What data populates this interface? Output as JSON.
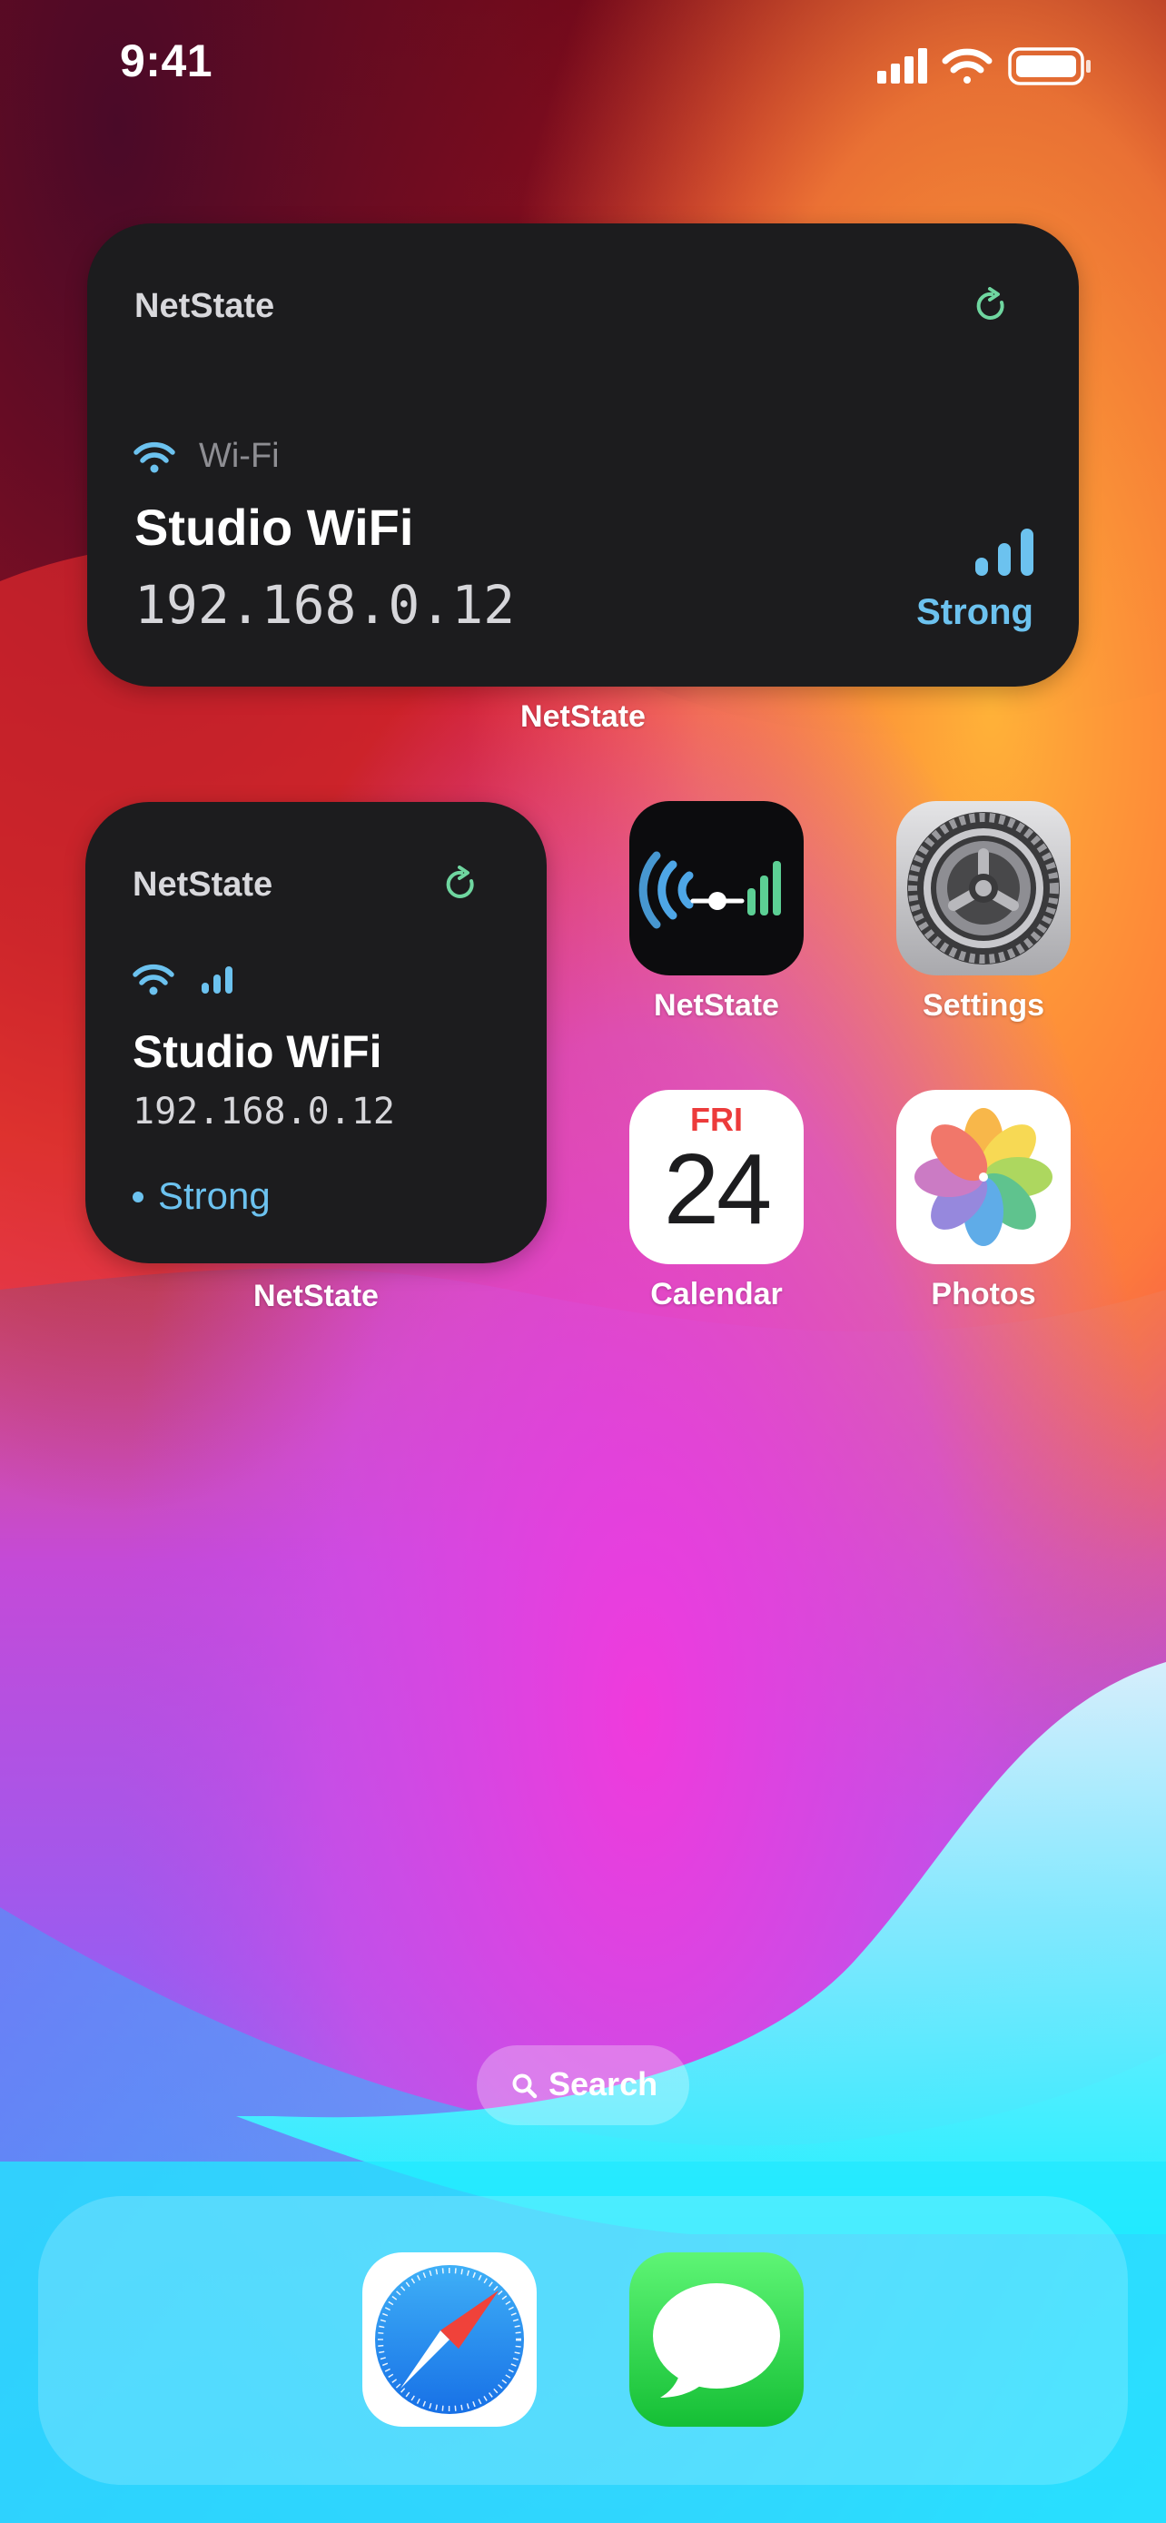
{
  "status_bar": {
    "time": "9:41"
  },
  "widget_large": {
    "app_name": "NetState",
    "connection_type": "Wi-Fi",
    "ssid": "Studio WiFi",
    "ip": "192.168.0.12",
    "strength": "Strong",
    "caption": "NetState"
  },
  "widget_small": {
    "app_name": "NetState",
    "ssid": "Studio WiFi",
    "ip": "192.168.0.12",
    "strength": "Strong",
    "caption": "NetState"
  },
  "apps": [
    {
      "label": "NetState",
      "icon": "netstate-app-icon"
    },
    {
      "label": "Settings",
      "icon": "settings-gear-icon"
    },
    {
      "label": "Calendar",
      "icon": "calendar-icon",
      "day": "FRI",
      "date": "24"
    },
    {
      "label": "Photos",
      "icon": "photos-flower-icon"
    }
  ],
  "search": {
    "label": "Search"
  },
  "dock": [
    {
      "icon": "safari-compass-icon"
    },
    {
      "icon": "messages-bubble-icon"
    }
  ],
  "colors": {
    "widget_bg": "#1c1c1e",
    "accent_blue": "#6cc2ef",
    "accent_green": "#6fd6a0"
  }
}
